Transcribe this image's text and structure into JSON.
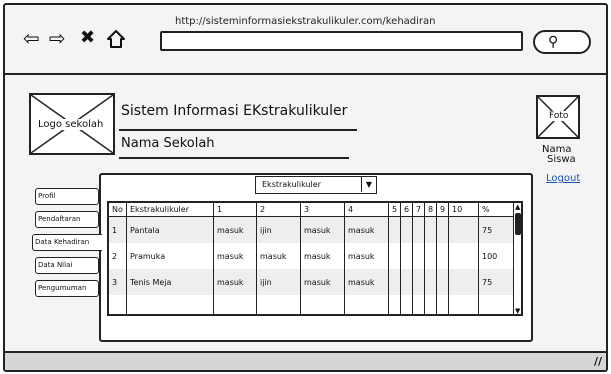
{
  "browser": {
    "url": "http://sisteminformasiekstrakulikuler.com/kehadiran",
    "back_icon": "arrow-left-icon",
    "forward_icon": "arrow-right-icon",
    "close_icon": "close-icon",
    "home_icon": "home-icon",
    "search_icon": "search-icon"
  },
  "header": {
    "logo_label": "Logo sekolah",
    "title": "Sistem Informasi EKstrakulikuler",
    "school_name": "Nama Sekolah",
    "photo_label": "Foto",
    "student_name": "Nama\n Siswa",
    "logout": "Logout"
  },
  "menu": {
    "items": [
      {
        "label": "Profil"
      },
      {
        "label": "Pendaftaran"
      },
      {
        "label": "Data Kehadiran"
      },
      {
        "label": "Data Nilai"
      },
      {
        "label": "Pengumuman"
      }
    ]
  },
  "filter": {
    "selected": "Ekstrakulikuler"
  },
  "table": {
    "headers": [
      "No",
      "Ekstrakulikuler",
      "1",
      "2",
      "3",
      "4",
      "5",
      "6",
      "7",
      "8",
      "9",
      "10",
      "%"
    ],
    "rows": [
      [
        "1",
        "Pantala",
        "masuk",
        "ijin",
        "masuk",
        "masuk",
        "",
        "",
        "",
        "",
        "",
        "",
        "75"
      ],
      [
        "2",
        "Pramuka",
        "masuk",
        "masuk",
        "masuk",
        "masuk",
        "",
        "",
        "",
        "",
        "",
        "",
        "100"
      ],
      [
        "3",
        "Tenis Meja",
        "masuk",
        "ijin",
        "masuk",
        "masuk",
        "",
        "",
        "",
        "",
        "",
        "",
        "75"
      ]
    ]
  },
  "colors": {
    "link": "#1a55b3",
    "row_alt": "#eeeeee",
    "status_bar": "#d6d6d6"
  }
}
